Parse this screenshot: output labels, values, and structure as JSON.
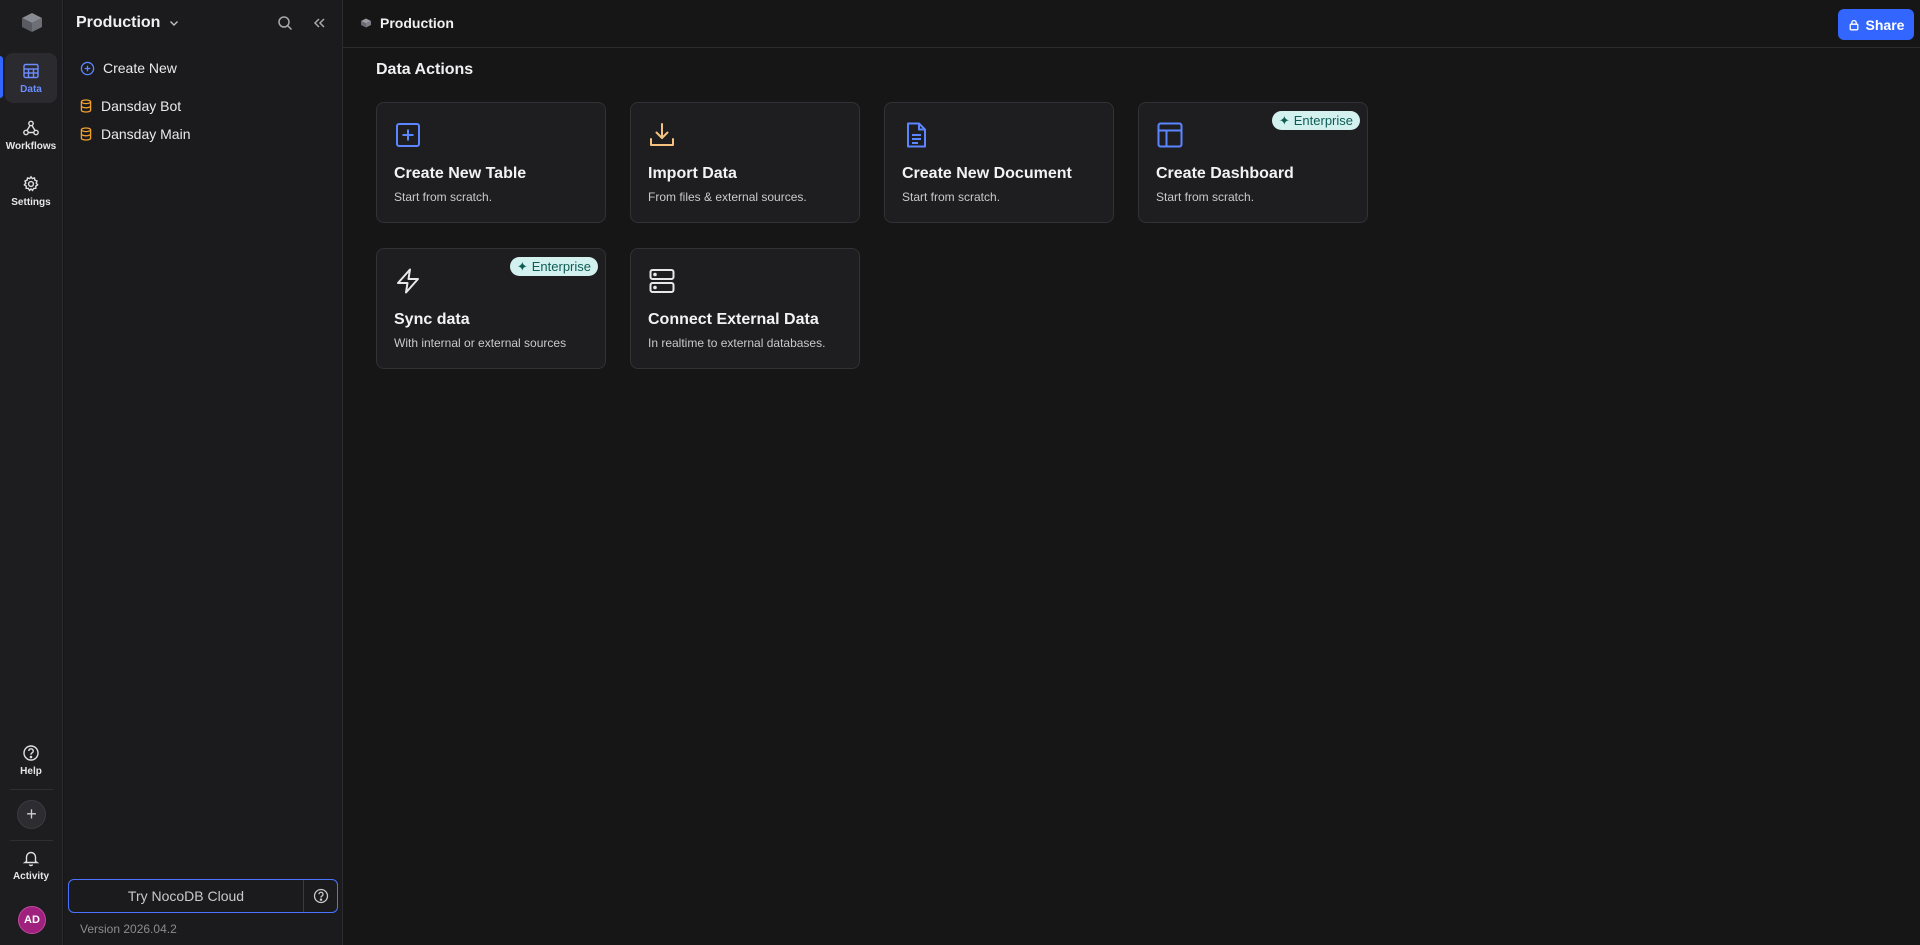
{
  "rail": {
    "items": [
      {
        "label": "Data",
        "icon": "table-icon",
        "active": true
      },
      {
        "label": "Workflows",
        "icon": "workflow-icon",
        "active": false
      },
      {
        "label": "Settings",
        "icon": "gear-icon",
        "active": false
      }
    ],
    "help_label": "Help",
    "activity_label": "Activity",
    "avatar_initials": "AD"
  },
  "sidebar": {
    "title": "Production",
    "create_new": "Create New",
    "bases": [
      {
        "label": "Dansday Bot"
      },
      {
        "label": "Dansday Main"
      }
    ],
    "cloud_button": "Try NocoDB Cloud",
    "version": "Version 2026.04.2"
  },
  "topbar": {
    "breadcrumb": "Production",
    "share_label": "Share"
  },
  "main": {
    "section_title": "Data Actions",
    "cards": [
      {
        "title": "Create New Table",
        "subtitle": "Start from scratch.",
        "icon": "plus-square-icon",
        "badge": ""
      },
      {
        "title": "Import Data",
        "subtitle": "From files & external sources.",
        "icon": "download-icon",
        "badge": ""
      },
      {
        "title": "Create New Document",
        "subtitle": "Start from scratch.",
        "icon": "document-icon",
        "badge": ""
      },
      {
        "title": "Create Dashboard",
        "subtitle": "Start from scratch.",
        "icon": "dashboard-icon",
        "badge": "Enterprise"
      },
      {
        "title": "Sync data",
        "subtitle": "With internal or external sources",
        "icon": "lightning-icon",
        "badge": "Enterprise"
      },
      {
        "title": "Connect External Data",
        "subtitle": "In realtime to external databases.",
        "icon": "server-icon",
        "badge": ""
      }
    ]
  },
  "colors": {
    "accent": "#3366ff",
    "background": "#161616",
    "base_icon": "#f0a030",
    "badge_bg": "#d3f1ee"
  }
}
